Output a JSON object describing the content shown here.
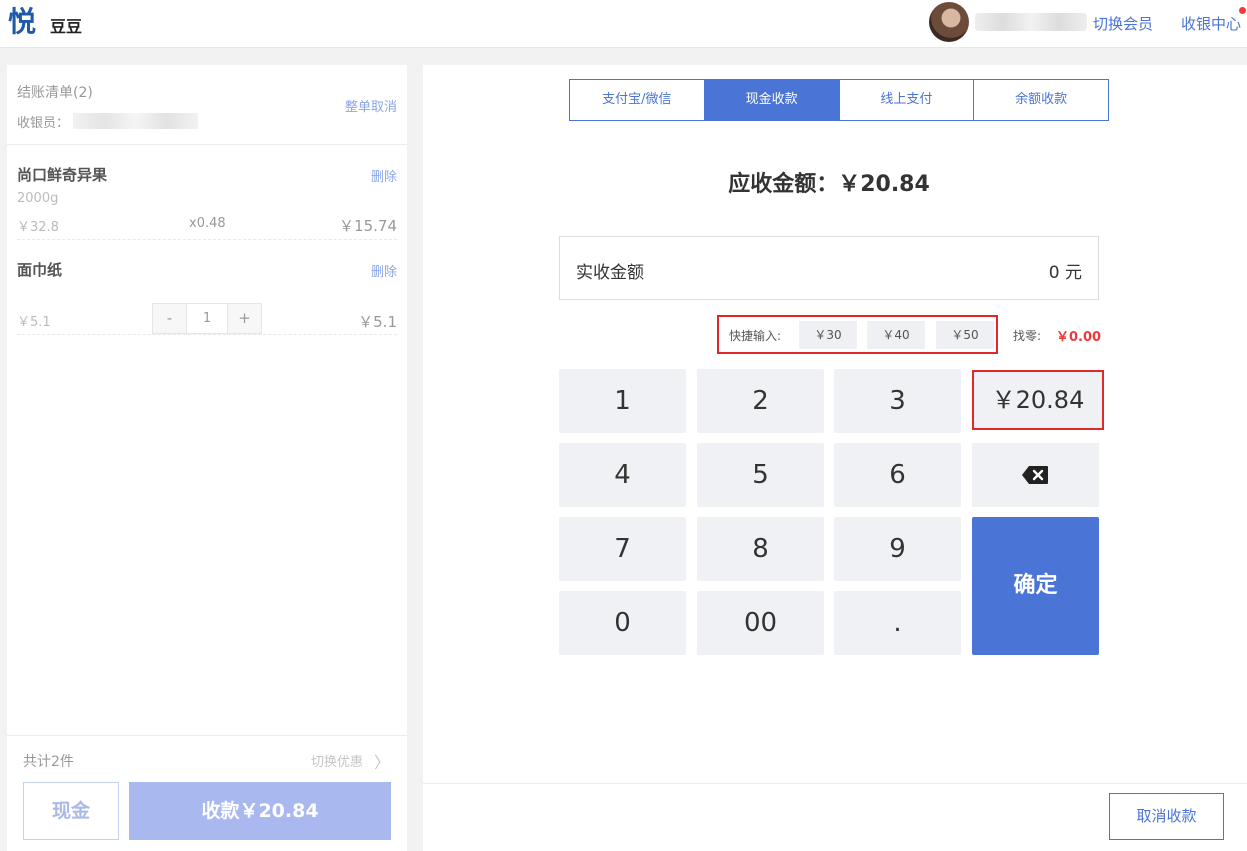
{
  "header": {
    "logo": "悦",
    "store_name": "豆豆",
    "switch_member": "切换会员",
    "cashier_center": "收银中心"
  },
  "order": {
    "title": "结账清单(2)",
    "cashier_label": "收银员：",
    "cancel_all": "整单取消",
    "items": [
      {
        "name": "尚口鲜奇异果",
        "delete": "删除",
        "spec": "2000g",
        "unit_price": "￥32.8",
        "qty": "x0.48",
        "total": "￥15.74"
      },
      {
        "name": "面巾纸",
        "delete": "删除",
        "unit_price": "￥5.1",
        "stepper_minus": "-",
        "stepper_value": "1",
        "stepper_plus": "+",
        "total": "￥5.1"
      }
    ],
    "total_count": "共计2件",
    "switch_discount": "切换优惠",
    "chevron": "〉",
    "cash_button": "现金",
    "collect_button": "收款￥20.84"
  },
  "payment": {
    "tabs": [
      "支付宝/微信",
      "现金收款",
      "线上支付",
      "余额收款"
    ],
    "active_tab": 1,
    "amount_due": "应收金额：￥20.84",
    "received_label": "实收金额",
    "received_value": "0 元",
    "quick_label": "快捷输入:",
    "quick_values": [
      "￥30",
      "￥40",
      "￥50"
    ],
    "change_label": "找零:",
    "change_value": "￥0.00",
    "keys": [
      "1",
      "2",
      "3",
      "4",
      "5",
      "6",
      "7",
      "8",
      "9",
      "0",
      "00",
      "."
    ],
    "amount_key": "￥20.84",
    "confirm": "确定",
    "cancel": "取消收款"
  },
  "colors": {
    "primary": "#4a74d6",
    "highlight_border": "#e02828",
    "change_red": "#f03a3a",
    "collect_disabled": "#a9b9ef"
  }
}
